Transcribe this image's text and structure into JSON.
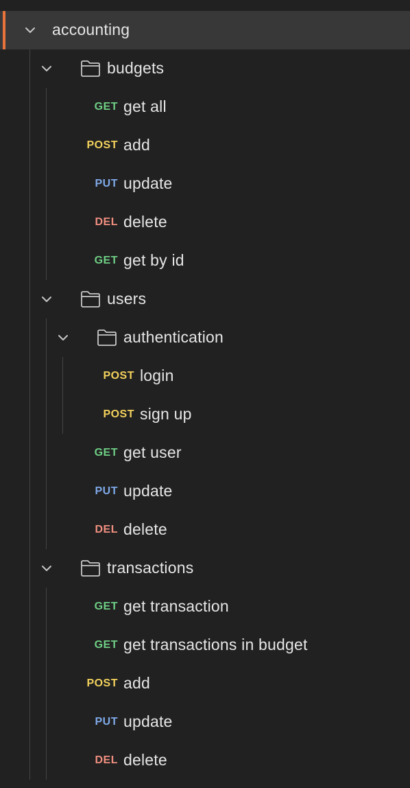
{
  "colors": {
    "background": "#212121",
    "selected_row": "#383838",
    "accent": "#e8743b",
    "text": "#e6e6e6",
    "icon": "#c8c8c8",
    "guide": "#444444",
    "GET": "#6fcf85",
    "POST": "#f2d15c",
    "PUT": "#7fa9e8",
    "DEL": "#f08f80"
  },
  "tree": {
    "collection": {
      "label": "accounting",
      "icon": "chevron-down-icon",
      "expanded": true,
      "selected": true
    },
    "budgets": {
      "label": "budgets",
      "icon": "folder-icon",
      "requests": [
        {
          "method": "GET",
          "label": "get all"
        },
        {
          "method": "POST",
          "label": "add"
        },
        {
          "method": "PUT",
          "label": "update"
        },
        {
          "method": "DEL",
          "label": "delete"
        },
        {
          "method": "GET",
          "label": "get by id"
        }
      ]
    },
    "users": {
      "label": "users",
      "icon": "folder-icon",
      "authentication": {
        "label": "authentication",
        "icon": "folder-icon",
        "requests": [
          {
            "method": "POST",
            "label": "login"
          },
          {
            "method": "POST",
            "label": "sign up"
          }
        ]
      },
      "requests": [
        {
          "method": "GET",
          "label": "get user"
        },
        {
          "method": "PUT",
          "label": "update"
        },
        {
          "method": "DEL",
          "label": "delete"
        }
      ]
    },
    "transactions": {
      "label": "transactions",
      "icon": "folder-icon",
      "requests": [
        {
          "method": "GET",
          "label": "get transaction"
        },
        {
          "method": "GET",
          "label": "get transactions in budget"
        },
        {
          "method": "POST",
          "label": "add"
        },
        {
          "method": "PUT",
          "label": "update"
        },
        {
          "method": "DEL",
          "label": "delete"
        }
      ]
    }
  }
}
